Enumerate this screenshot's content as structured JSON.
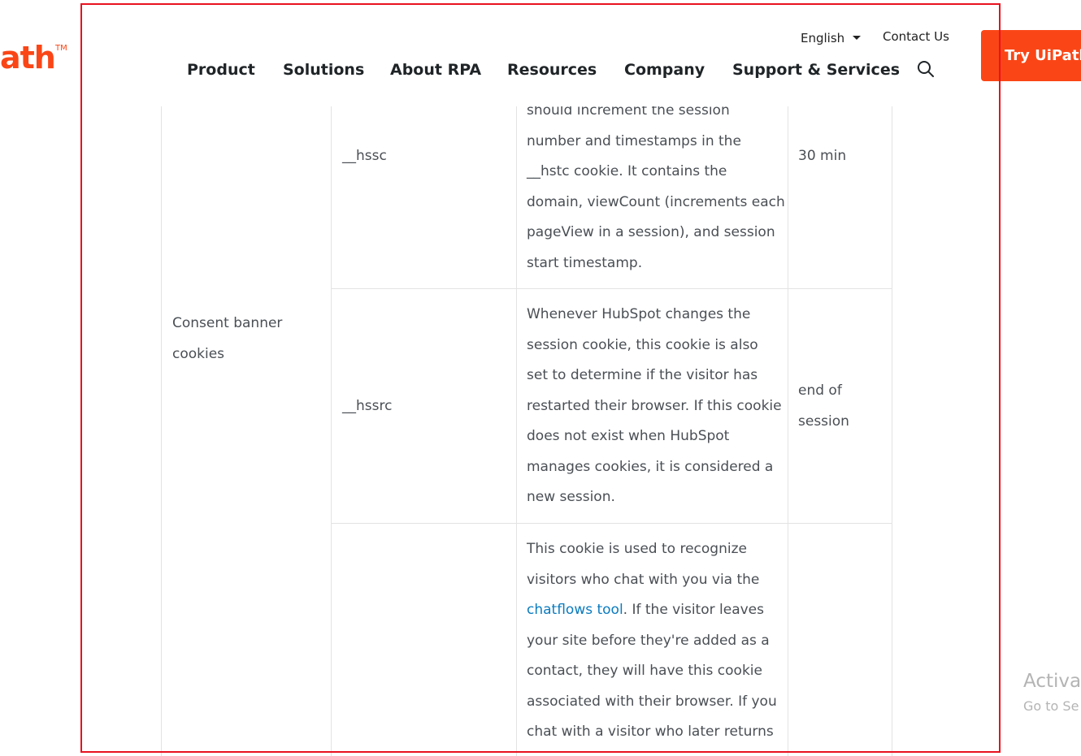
{
  "header": {
    "logo_text": "ath",
    "logo_tm": "TM",
    "language": "English",
    "contact_label": "Contact Us",
    "nav": [
      "Product",
      "Solutions",
      "About RPA",
      "Resources",
      "Company",
      "Support & Services"
    ],
    "cta_label": "Try UiPath",
    "brand_color": "#fa4616"
  },
  "table": {
    "category": [
      "Consent banner",
      "cookies"
    ],
    "rows": [
      {
        "name": "__hssc",
        "description": [
          "should increment the session",
          "number and timestamps in the",
          "__hstc cookie. It contains the",
          "domain, viewCount (increments each",
          "pageView in a session), and session",
          "start timestamp."
        ],
        "duration": [
          "30 min"
        ]
      },
      {
        "name": "__hssrc",
        "description": [
          "Whenever HubSpot changes the",
          "session cookie, this cookie is also",
          "set to determine if the visitor has",
          "restarted their browser. If this cookie",
          "does not exist when HubSpot",
          "manages cookies, it is considered a",
          "new session."
        ],
        "duration": [
          "end of",
          "session"
        ]
      },
      {
        "name": "",
        "description_line_1": "This cookie is used to recognize",
        "description_line_2": "visitors who chat with you via the",
        "description_link": "chatflows tool",
        "description_line_3_rest": ". If the visitor leaves",
        "description_rest": [
          "your site before they're added as a",
          "contact, they will have this cookie",
          "associated with their browser. If you",
          "chat with a visitor who later returns"
        ],
        "duration": []
      }
    ]
  },
  "watermark": {
    "title": "Activat",
    "subtitle": "Go to Se"
  }
}
